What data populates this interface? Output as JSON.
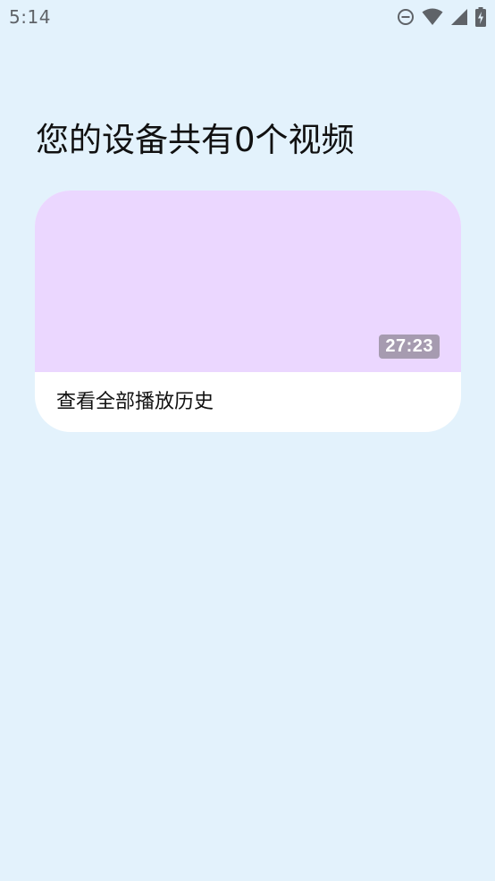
{
  "status_bar": {
    "time": "5:14",
    "icons": [
      "do-not-disturb-icon",
      "wifi-icon",
      "signal-icon",
      "battery-charging-icon"
    ]
  },
  "page": {
    "title": "您的设备共有0个视频"
  },
  "history_card": {
    "duration": "27:23",
    "label": "查看全部播放历史",
    "thumbnail_color": "#EBD7FF"
  },
  "colors": {
    "background": "#E3F2FC",
    "card": "#FFFFFF",
    "badge": "#A69BB0"
  }
}
